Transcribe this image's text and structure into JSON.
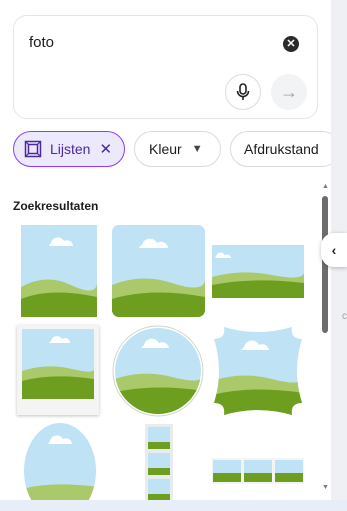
{
  "search": {
    "query": "foto",
    "placeholder": ""
  },
  "chips": [
    {
      "label": "Lijsten",
      "active": true
    },
    {
      "label": "Kleur"
    },
    {
      "label": "Afdrukstand"
    }
  ],
  "results": {
    "heading": "Zoekresultaten",
    "items": [
      "portrait-frame",
      "rounded-square-frame",
      "landscape-frame",
      "polaroid-frame",
      "circle-frame",
      "ornamental-frame",
      "oval-frame",
      "filmstrip-frame",
      "triple-strip-frame"
    ]
  },
  "colors": {
    "accent": "#8b3dff",
    "sky": "#bfe3f5",
    "grass": "#6e9e1f"
  }
}
